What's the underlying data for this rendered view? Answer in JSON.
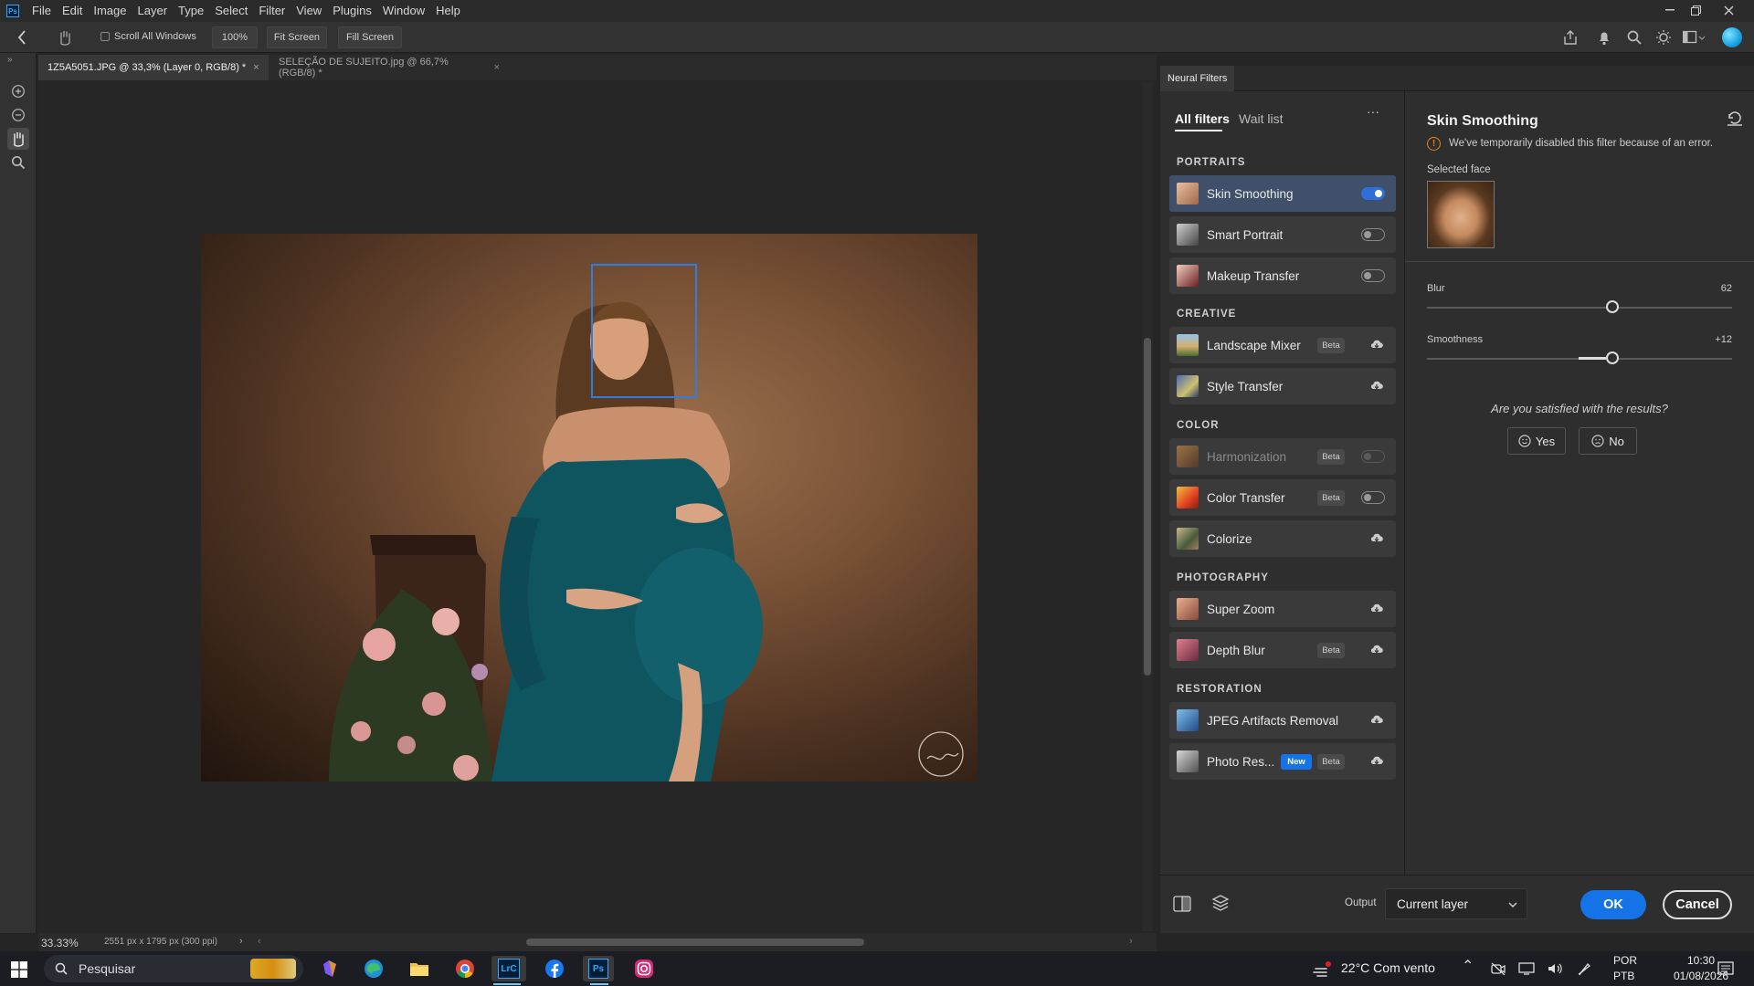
{
  "menubar": {
    "logo": "Ps",
    "items": [
      "File",
      "Edit",
      "Image",
      "Layer",
      "Type",
      "Select",
      "Filter",
      "View",
      "Plugins",
      "Window",
      "Help"
    ]
  },
  "options": {
    "scroll_all": "Scroll All Windows",
    "zoom_100": "100%",
    "fit_screen": "Fit Screen",
    "fill_screen": "Fill Screen"
  },
  "tabs": [
    {
      "label": "1Z5A5051.JPG @ 33,3% (Layer 0, RGB/8) *",
      "active": true
    },
    {
      "label": "SELEÇÃO DE SUJEITO.jpg @ 66,7% (RGB/8) *",
      "active": false
    }
  ],
  "status": {
    "zoom": "33.33%",
    "info": "2551 px x 1795 px (300 ppi)"
  },
  "neural": {
    "panel_title": "Neural Filters",
    "tab_all": "All filters",
    "tab_wait": "Wait list",
    "more": "···",
    "categories": {
      "portraits": "PORTRAITS",
      "creative": "CREATIVE",
      "color": "COLOR",
      "photography": "PHOTOGRAPHY",
      "restoration": "RESTORATION"
    },
    "filters": {
      "skin_smoothing": "Skin Smoothing",
      "smart_portrait": "Smart Portrait",
      "makeup_transfer": "Makeup Transfer",
      "landscape_mixer": "Landscape Mixer",
      "style_transfer": "Style Transfer",
      "harmonization": "Harmonization",
      "color_transfer": "Color Transfer",
      "colorize": "Colorize",
      "super_zoom": "Super Zoom",
      "depth_blur": "Depth Blur",
      "jpeg_artifacts": "JPEG Artifacts Removal",
      "photo_restoration": "Photo Res..."
    },
    "badge_beta": "Beta",
    "badge_new": "New",
    "settings": {
      "title": "Skin Smoothing",
      "error": "We've temporarily disabled this filter because of an error.",
      "selected_face": "Selected face",
      "blur_label": "Blur",
      "blur_value": "62",
      "blur_fraction": 0.62,
      "smooth_label": "Smoothness",
      "smooth_value": "+12",
      "smooth_fraction": 0.62,
      "question": "Are you satisfied with the results?",
      "yes": "Yes",
      "no": "No"
    },
    "footer": {
      "output_label": "Output",
      "output_value": "Current layer",
      "ok": "OK",
      "cancel": "Cancel"
    }
  },
  "taskbar": {
    "search": "Pesquisar",
    "weather": "22°C  Com vento",
    "lang1": "POR",
    "lang2": "PTB",
    "time": "10:30",
    "date": "01/08/2026"
  },
  "colors": {
    "accent": "#1473e6",
    "selected_row": "#40506a",
    "face_box": "#2f7de0",
    "warning": "#e68619"
  }
}
